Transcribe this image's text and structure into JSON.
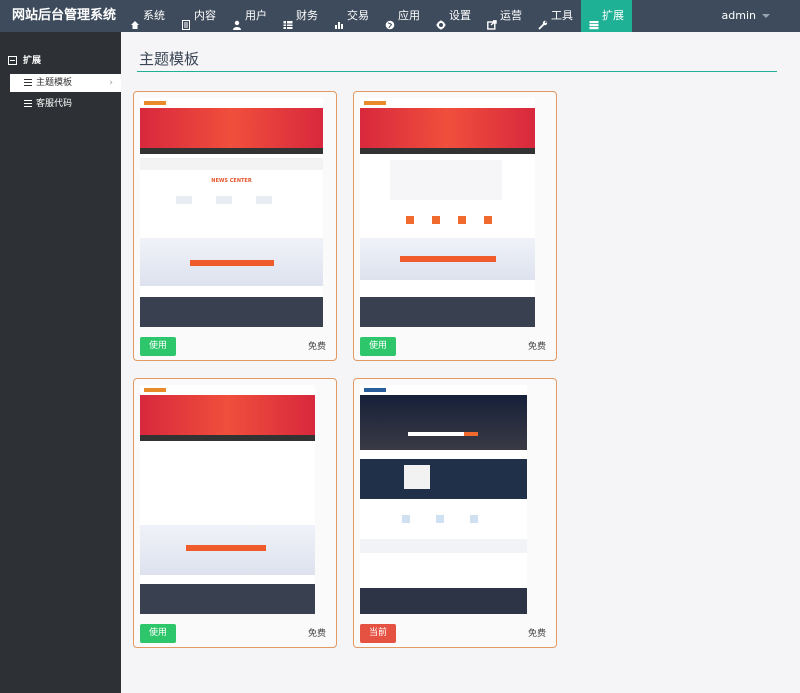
{
  "app": {
    "title": "网站后台管理系统",
    "user": "admin"
  },
  "nav": {
    "items": [
      {
        "label": "系统",
        "icon": "home-icon"
      },
      {
        "label": "内容",
        "icon": "document-icon"
      },
      {
        "label": "用户",
        "icon": "user-icon"
      },
      {
        "label": "财务",
        "icon": "table-icon"
      },
      {
        "label": "交易",
        "icon": "bar-chart-icon"
      },
      {
        "label": "应用",
        "icon": "globe-icon"
      },
      {
        "label": "设置",
        "icon": "gear-icon"
      },
      {
        "label": "运营",
        "icon": "share-icon"
      },
      {
        "label": "工具",
        "icon": "wrench-icon"
      },
      {
        "label": "扩展",
        "icon": "stack-icon"
      }
    ],
    "active_index": 9
  },
  "sidebar": {
    "group_label": "扩展",
    "items": [
      {
        "label": "主题模板",
        "active": true
      },
      {
        "label": "客服代码",
        "active": false
      }
    ]
  },
  "main": {
    "title": "主题模板",
    "cards": [
      {
        "button": "使用",
        "price": "免费",
        "current": false,
        "thumb_heading": "NEWS CENTER"
      },
      {
        "button": "使用",
        "price": "免费",
        "current": false
      },
      {
        "button": "使用",
        "price": "免费",
        "current": false
      },
      {
        "button": "当前",
        "price": "免费",
        "current": true
      }
    ]
  },
  "colors": {
    "topbar": "#3e4b5c",
    "accent": "#1fb196",
    "sidebar": "#2d3135",
    "use_button": "#2ec66b",
    "current_button": "#e55241",
    "card_border": "#e39a62"
  }
}
